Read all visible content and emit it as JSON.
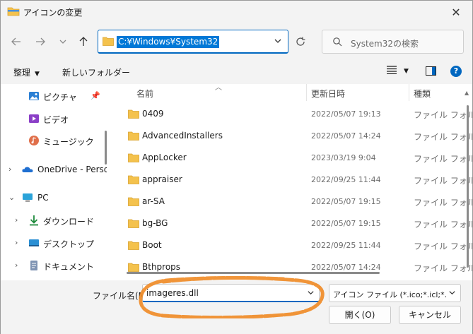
{
  "window": {
    "title": "アイコンの変更",
    "close_glyph": "✕"
  },
  "nav": {
    "address": "C:¥Windows¥System32",
    "search_placeholder": "System32の検索"
  },
  "toolbar": {
    "organize_label": "整理",
    "new_folder_label": "新しいフォルダー"
  },
  "sidebar": {
    "items": [
      {
        "label": "ピクチャ",
        "icon": "pictures-icon",
        "chevron": false,
        "pinned": true
      },
      {
        "label": "ビデオ",
        "icon": "videos-icon",
        "chevron": false,
        "pinned": false
      },
      {
        "label": "ミュージック",
        "icon": "music-icon",
        "chevron": false,
        "pinned": false
      },
      {
        "label": "OneDrive - Perso",
        "icon": "onedrive-icon",
        "chevron": "right",
        "pinned": false
      },
      {
        "label": "PC",
        "icon": "pc-icon",
        "chevron": "down",
        "pinned": false
      },
      {
        "label": "ダウンロード",
        "icon": "download-icon",
        "chevron": "right",
        "pinned": false
      },
      {
        "label": "デスクトップ",
        "icon": "desktop-icon",
        "chevron": "right",
        "pinned": false
      },
      {
        "label": "ドキュメント",
        "icon": "documents-icon",
        "chevron": "right",
        "pinned": false
      }
    ]
  },
  "columns": {
    "name": "名前",
    "date": "更新日時",
    "type": "種類"
  },
  "files": [
    {
      "name": "0409",
      "date": "2022/05/07 19:13",
      "type": "ファイル フォルダー"
    },
    {
      "name": "AdvancedInstallers",
      "date": "2022/05/07 14:24",
      "type": "ファイル フォルダー"
    },
    {
      "name": "AppLocker",
      "date": "2023/03/19 9:04",
      "type": "ファイル フォルダー"
    },
    {
      "name": "appraiser",
      "date": "2022/09/25 11:44",
      "type": "ファイル フォルダー"
    },
    {
      "name": "ar-SA",
      "date": "2022/05/07 19:15",
      "type": "ファイル フォルダー"
    },
    {
      "name": "bg-BG",
      "date": "2022/05/07 19:15",
      "type": "ファイル フォルダー"
    },
    {
      "name": "Boot",
      "date": "2022/09/25 11:44",
      "type": "ファイル フォルダー"
    },
    {
      "name": "Bthprops",
      "date": "2022/05/07 14:24",
      "type": "ファイル フォルダー"
    }
  ],
  "bottom": {
    "filename_label": "ファイル名(N):",
    "filename_value": "imageres.dll",
    "filetype_value": "アイコン ファイル (*.ico;*.icl;*.exe;*.dll)",
    "open_label": "開く(O)",
    "cancel_label": "キャンセル"
  },
  "colors": {
    "accent": "#0067c0",
    "folder": "#f4c24d",
    "annotation": "#f08a24"
  }
}
